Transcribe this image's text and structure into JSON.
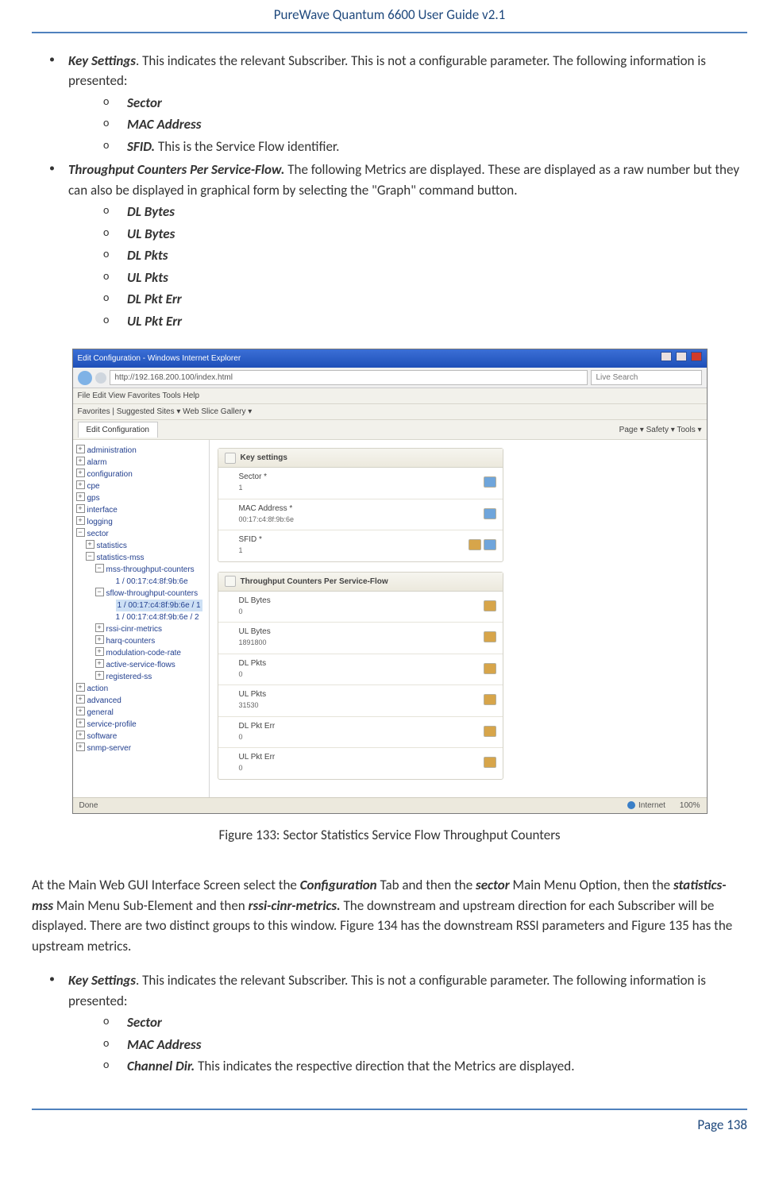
{
  "header": {
    "title": "PureWave Quantum 6600 User Guide v2.1"
  },
  "footer": {
    "page": "Page 138"
  },
  "bullet1": {
    "label": "Key Settings",
    "desc": ". This indicates the relevant Subscriber. This is not a configurable parameter. The following information is presented:",
    "sub": {
      "a": "Sector",
      "b": "MAC Address",
      "c_label": "SFID.",
      "c_desc": " This is the Service Flow identifier."
    }
  },
  "bullet2": {
    "label": "Throughput Counters Per Service-Flow.",
    "desc": " The following Metrics are displayed. These are displayed as a raw number but they can also be displayed in graphical form by selecting the \"Graph\" command button.",
    "sub": {
      "a": "DL Bytes",
      "b": "UL Bytes",
      "c": "DL Pkts",
      "d": "UL Pkts",
      "e": "DL Pkt Err",
      "f": "UL Pkt Err"
    }
  },
  "figure": {
    "titlebar": "Edit Configuration - Windows Internet Explorer",
    "url": "http://192.168.200.100/index.html",
    "search": "Live Search",
    "menu": "File   Edit   View   Favorites   Tools   Help",
    "favbar": "Favorites    |    Suggested Sites ▾    Web Slice Gallery ▾",
    "tab": "Edit Configuration",
    "toolbar_right": "Page ▾   Safety ▾   Tools ▾",
    "tree": {
      "n0": "administration",
      "n1": "alarm",
      "n2": "configuration",
      "n3": "cpe",
      "n4": "gps",
      "n5": "interface",
      "n6": "logging",
      "n7": "sector",
      "n7a": "statistics",
      "n7b": "statistics-mss",
      "n7c": "mss-throughput-counters",
      "n7c1": "1 / 00:17:c4:8f:9b:6e",
      "n7d": "sflow-throughput-counters",
      "n7d1": "1 / 00:17:c4:8f:9b:6e / 1",
      "n7d2": "1 / 00:17:c4:8f:9b:6e / 2",
      "n7e": "rssi-cinr-metrics",
      "n7f": "harq-counters",
      "n7g": "modulation-code-rate",
      "n7h": "active-service-flows",
      "n7i": "registered-ss",
      "n8": "action",
      "n9": "advanced",
      "n10": "general",
      "n11": "service-profile",
      "n12": "software",
      "n13": "snmp-server"
    },
    "key_panel": {
      "header": "Key settings",
      "sector_lab": "Sector *",
      "sector_val": "1",
      "mac_lab": "MAC Address *",
      "mac_val": "00:17:c4:8f:9b:6e",
      "sfid_lab": "SFID *",
      "sfid_val": "1"
    },
    "tp_panel": {
      "header": "Throughput Counters Per Service-Flow",
      "r1_lab": "DL Bytes",
      "r1_val": "0",
      "r2_lab": "UL Bytes",
      "r2_val": "1891800",
      "r3_lab": "DL Pkts",
      "r3_val": "0",
      "r4_lab": "UL Pkts",
      "r4_val": "31530",
      "r5_lab": "DL Pkt Err",
      "r5_val": "0",
      "r6_lab": "UL Pkt Err",
      "r6_val": "0"
    },
    "status": {
      "done": "Done",
      "zone": "Internet",
      "zoom": "100%"
    },
    "caption": "Figure 133: Sector Statistics Service Flow Throughput Counters"
  },
  "para2": {
    "t1": "At the Main Web GUI Interface Screen select the ",
    "b1": "Configuration",
    "t2": " Tab and then the ",
    "b2": "sector",
    "t3": " Main Menu Option, then the ",
    "b3": "statistics-mss",
    "t4": " Main Menu Sub-Element and then ",
    "b4": "rssi-cinr-metrics.",
    "t5": " The downstream and upstream direction for each Subscriber will be displayed. There are two distinct groups to this window. Figure 134 has the downstream RSSI parameters and Figure 135 has the upstream metrics."
  },
  "bullet3": {
    "label": "Key Settings",
    "desc": ". This indicates the relevant Subscriber. This is not a configurable parameter. The following information is presented:",
    "sub": {
      "a": "Sector",
      "b": "MAC Address",
      "c_label": "Channel Dir.",
      "c_desc": " This indicates the respective direction that the Metrics are displayed."
    }
  }
}
